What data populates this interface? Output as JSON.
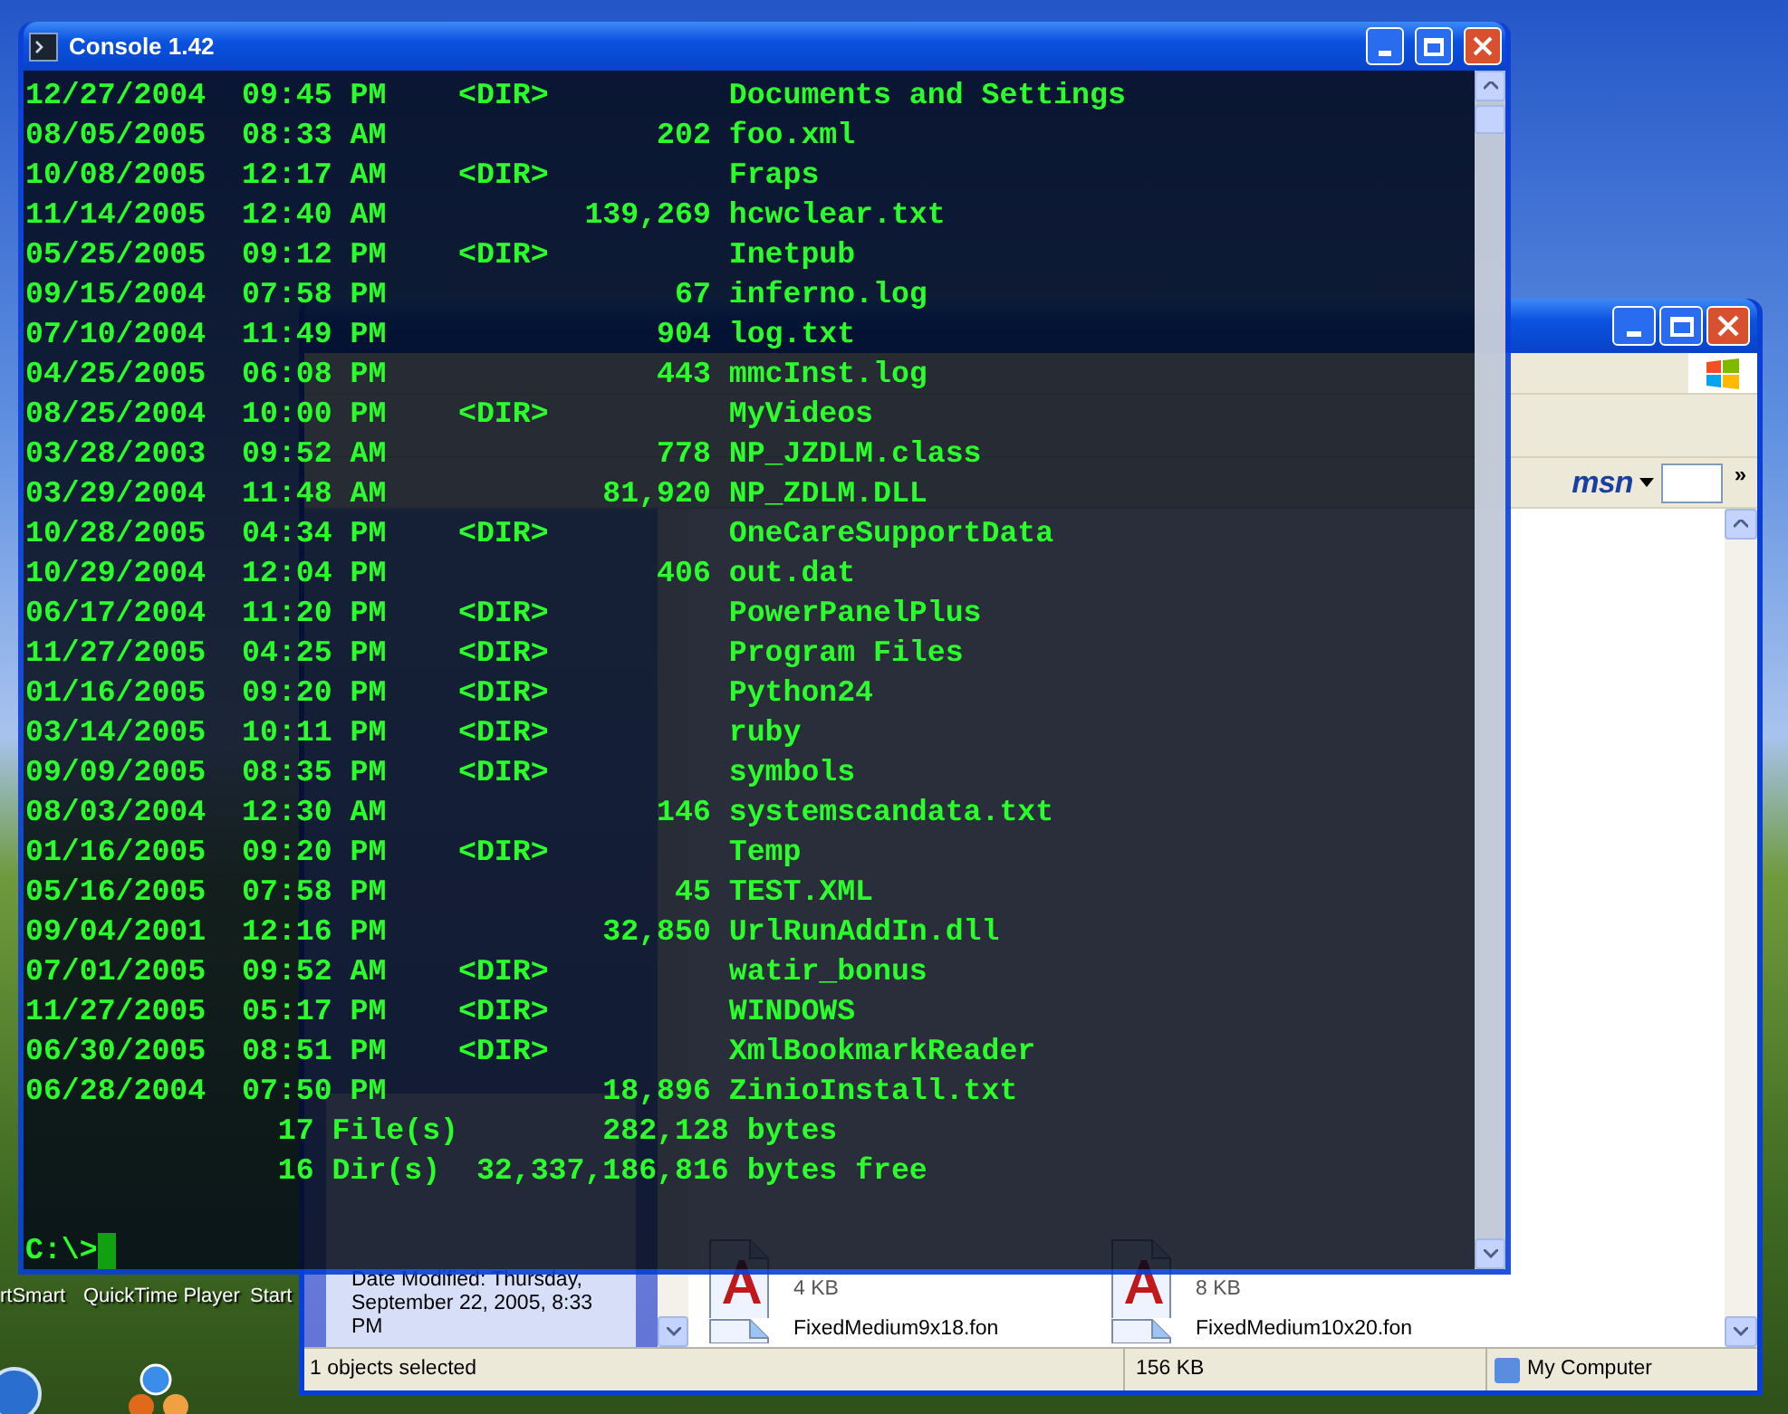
{
  "console": {
    "title": "Console 1.42",
    "lines": [
      "12/27/2004  09:45 PM    <DIR>          Documents and Settings",
      "08/05/2005  08:33 AM               202 foo.xml",
      "10/08/2005  12:17 AM    <DIR>          Fraps",
      "11/14/2005  12:40 AM           139,269 hcwclear.txt",
      "05/25/2005  09:12 PM    <DIR>          Inetpub",
      "09/15/2004  07:58 PM                67 inferno.log",
      "07/10/2004  11:49 PM               904 log.txt",
      "04/25/2005  06:08 PM               443 mmcInst.log",
      "08/25/2004  10:00 PM    <DIR>          MyVideos",
      "03/28/2003  09:52 AM               778 NP_JZDLM.class",
      "03/29/2004  11:48 AM            81,920 NP_ZDLM.DLL",
      "10/28/2005  04:34 PM    <DIR>          OneCareSupportData",
      "10/29/2004  12:04 PM               406 out.dat",
      "06/17/2004  11:20 PM    <DIR>          PowerPanelPlus",
      "11/27/2005  04:25 PM    <DIR>          Program Files",
      "01/16/2005  09:20 PM    <DIR>          Python24",
      "03/14/2005  10:11 PM    <DIR>          ruby",
      "09/09/2005  08:35 PM    <DIR>          symbols",
      "08/03/2004  12:30 AM               146 systemscandata.txt",
      "01/16/2005  09:20 PM    <DIR>          Temp",
      "05/16/2005  07:58 PM                45 TEST.XML",
      "09/04/2001  12:16 PM            32,850 UrlRunAddIn.dll",
      "07/01/2005  09:52 AM    <DIR>          watir_bonus",
      "11/27/2005  05:17 PM    <DIR>          WINDOWS",
      "06/30/2005  08:51 PM    <DIR>          XmlBookmarkReader",
      "06/28/2004  07:50 PM            18,896 ZinioInstall.txt",
      "              17 File(s)        282,128 bytes",
      "              16 Dir(s)  32,337,186,816 bytes free"
    ],
    "prompt": "C:\\>"
  },
  "explorer": {
    "search_logo": "msn",
    "toolbar_chevron": "»",
    "details": "Date Modified: Thursday, September 22, 2005, 8:33 PM",
    "files": [
      {
        "kind": "font",
        "size": "4 KB"
      },
      {
        "kind": "font",
        "size": "8 KB"
      },
      {
        "kind": "document",
        "name": "FixedMedium9x18.fon"
      },
      {
        "kind": "document",
        "name": "FixedMedium10x20.fon"
      }
    ],
    "status_bar": [
      "1 objects selected",
      "156 KB",
      "My Computer"
    ]
  },
  "desktop_icons": [
    "rtSmart",
    "QuickTime Player",
    "Start"
  ]
}
